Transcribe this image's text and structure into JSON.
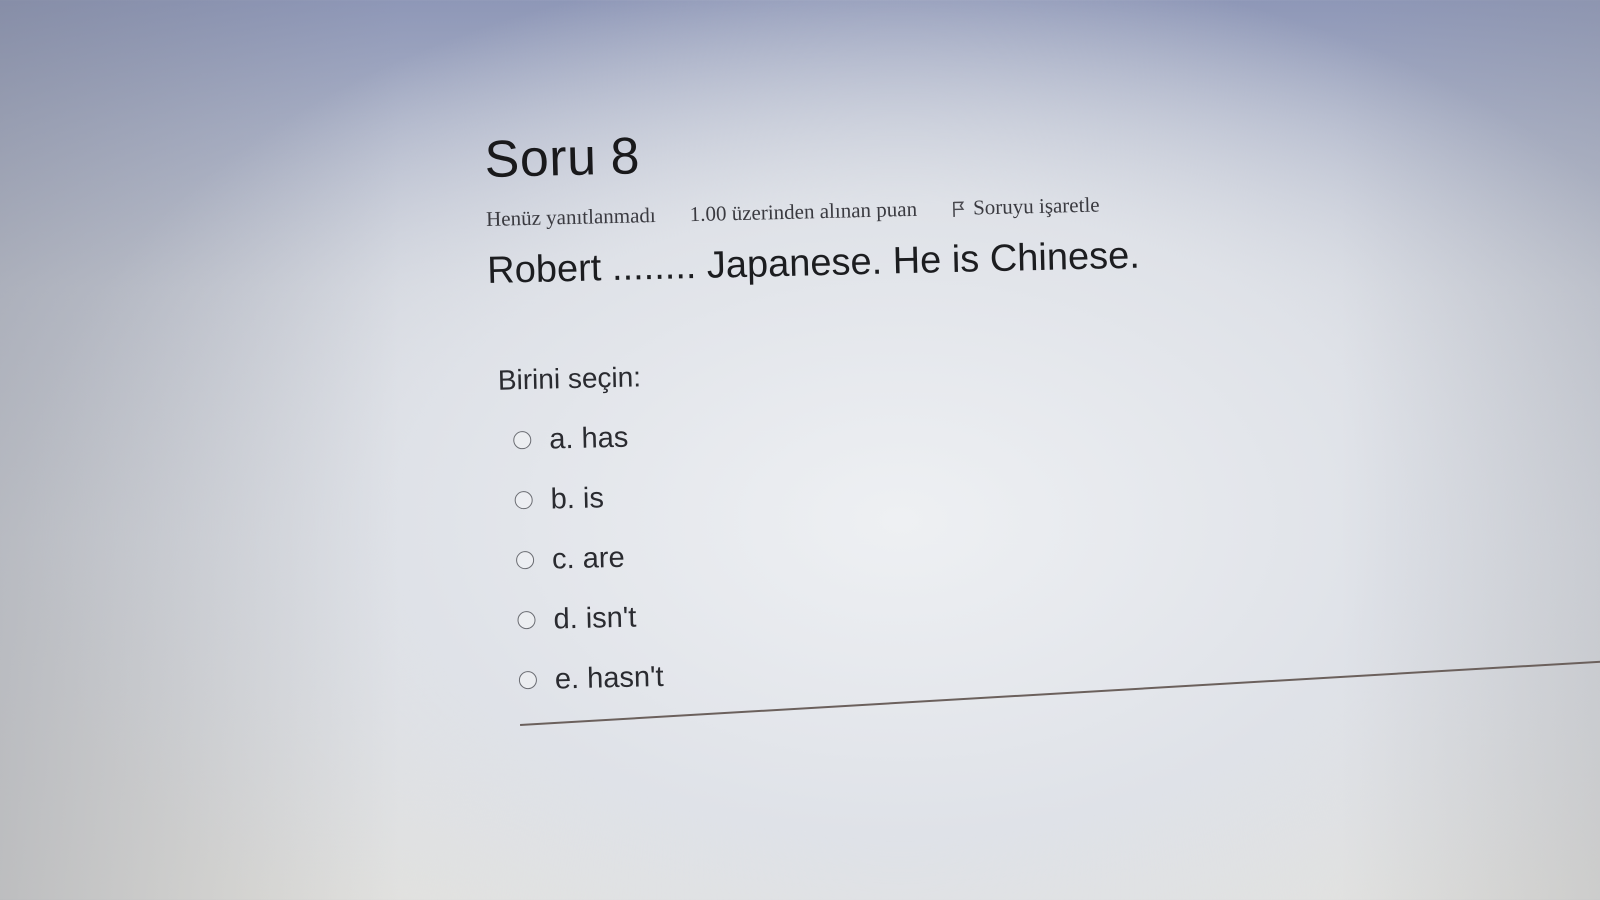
{
  "question": {
    "title_word": "Soru",
    "number": "8",
    "status": "Henüz yanıtlanmadı",
    "grade_info": "1.00 üzerinden alınan puan",
    "flag_label": "Soruyu işaretle",
    "flag_icon": "flag-icon",
    "text": "Robert ........ Japanese. He is Chinese.",
    "prompt": "Birini seçin:",
    "options": [
      {
        "letter": "a.",
        "label": "has"
      },
      {
        "letter": "b.",
        "label": "is"
      },
      {
        "letter": "c.",
        "label": "are"
      },
      {
        "letter": "d.",
        "label": "isn't"
      },
      {
        "letter": "e.",
        "label": "hasn't"
      }
    ]
  }
}
